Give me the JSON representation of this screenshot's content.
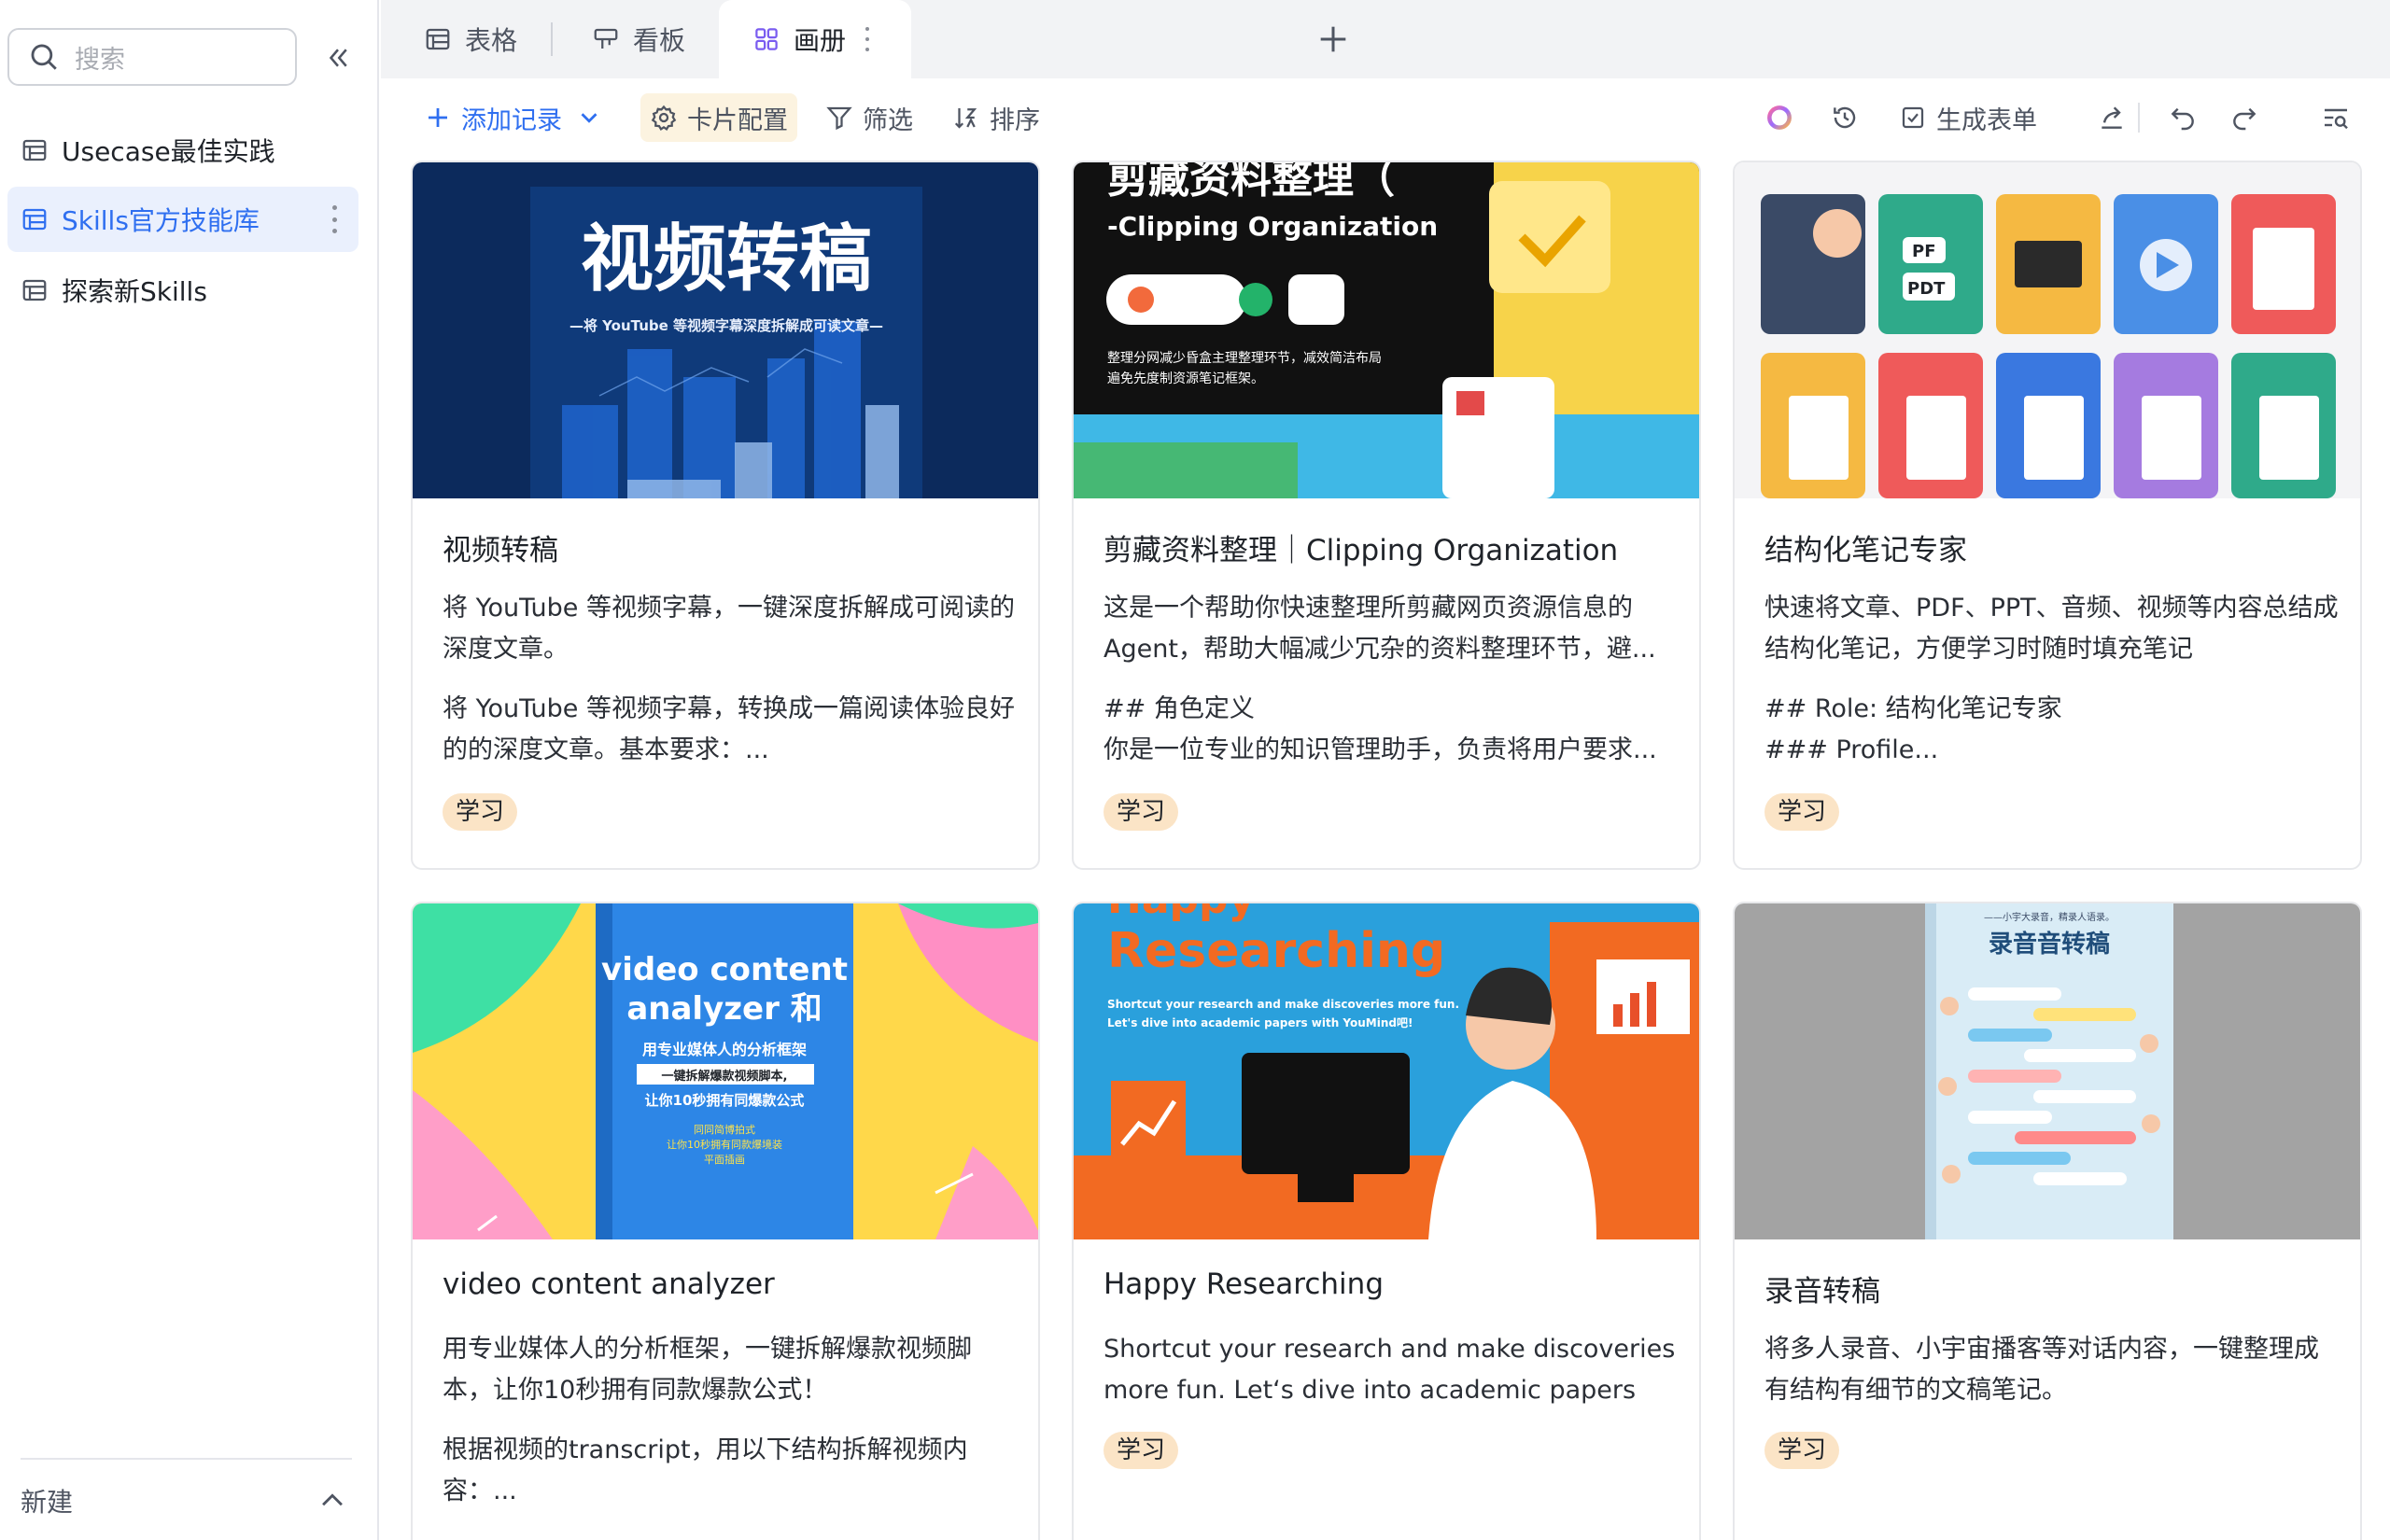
{
  "sidebar": {
    "search_placeholder": "搜索",
    "items": [
      {
        "label": "Usecase最佳实践"
      },
      {
        "label": "Skills官方技能库"
      },
      {
        "label": "探索新Skills"
      }
    ],
    "footer_label": "新建"
  },
  "tabs": [
    {
      "label": "表格",
      "icon": "table-icon"
    },
    {
      "label": "看板",
      "icon": "kanban-icon"
    },
    {
      "label": "画册",
      "icon": "gallery-icon"
    }
  ],
  "toolbar": {
    "add_record": "添加记录",
    "card_config": "卡片配置",
    "filter": "筛选",
    "sort": "排序",
    "generate_form": "生成表单"
  },
  "cards": [
    {
      "title": "视频转稿",
      "desc1": "将 YouTube 等视频字幕，一键深度拆解成可阅读的深度文章。",
      "desc2": "将 YouTube 等视频字幕，转换成一篇阅读体验良好的的深度文章。基本要求：...",
      "tag": "学习",
      "cover": {
        "headline": "视频转稿",
        "subline": "—将 YouTube 等视频字幕深度拆解成可读文章—"
      }
    },
    {
      "title": "剪藏资料整理｜Clipping Organization",
      "desc1": "这是一个帮助你快速整理所剪藏网页资源信息的Agent，帮助大幅减少冗杂的资料整理环节，避...",
      "desc2": "## 角色定义\n你是一位专业的知识管理助手，负责将用户要求...",
      "tag": "学习",
      "cover": {
        "headline": "剪藏资料整理（",
        "subline": "-Clipping Organization",
        "small1": "整理分网减少昏盒主理整理环节，减效简洁布局",
        "small2": "遍免先度制资源笔记框架。"
      }
    },
    {
      "title": "结构化笔记专家",
      "desc1": "快速将文章、PDF、PPT、音频、视频等内容总结成结构化笔记，方便学习时随时填充笔记",
      "desc2": "## Role: 结构化笔记专家\n### Profile...",
      "tag": "学习",
      "cover": {
        "pf": "PF",
        "pdt": "PDT"
      }
    },
    {
      "title": "video content analyzer",
      "desc1": "用专业媒体人的分析框架，一键拆解爆款视频脚本，让你10秒拥有同款爆款公式！",
      "desc2": "根据视频的transcript，用以下结构拆解视频内容：...",
      "tag": "学习",
      "cover": {
        "line1": "video content",
        "line2": "analyzer 和",
        "line3": "用专业媒体人的分析框架",
        "line4": "一键拆解爆款视频脚本,",
        "line5": "让你10秒拥有同爆款公式",
        "line6": "同同简博拍式",
        "line7": "让你10秒拥有同款爆境装",
        "line8": "平面插画"
      }
    },
    {
      "title": "Happy Researching",
      "desc1": "Shortcut your research and make discoveries more fun. Let‘s dive into academic papers wit...",
      "tag": "学习",
      "cover": {
        "top": "Happy",
        "headline": "Researching",
        "small1": "Shortcut your research and make discoveries more fun.",
        "small2": "Let's dive into academic papers with YouMind吧!"
      }
    },
    {
      "title": "录音转稿",
      "desc1": "将多人录音、小宇宙播客等对话内容，一键整理成有结构有细节的文稿笔记。",
      "tag": "学习",
      "cover": {
        "top": "——小宇大录音，精录人语录。",
        "headline": "录音音转稿"
      }
    }
  ]
}
